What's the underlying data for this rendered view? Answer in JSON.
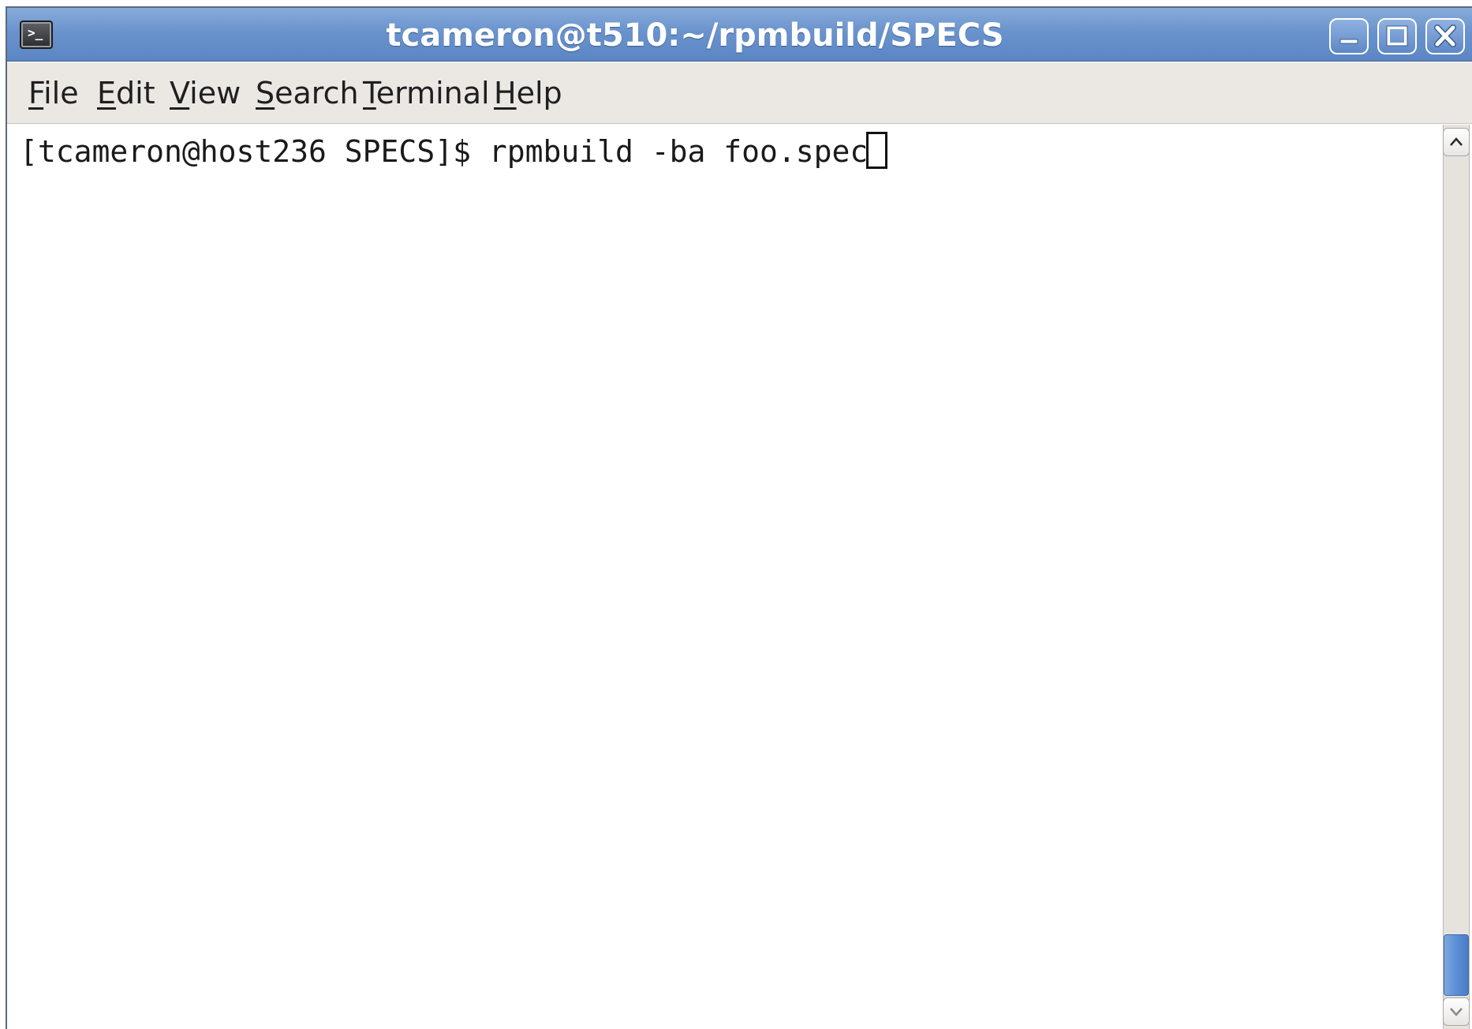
{
  "window": {
    "title": "tcameron@t510:~/rpmbuild/SPECS",
    "app_icon_glyph": ">_",
    "controls": [
      "minimize-icon",
      "maximize-icon",
      "close-icon"
    ]
  },
  "menu": {
    "items": [
      {
        "mnemonic": "F",
        "rest": "ile"
      },
      {
        "mnemonic": "E",
        "rest": "dit"
      },
      {
        "mnemonic": "V",
        "rest": "iew"
      },
      {
        "mnemonic": "S",
        "rest": "earch"
      },
      {
        "mnemonic": "T",
        "rest": "erminal"
      },
      {
        "mnemonic": "H",
        "rest": "elp"
      }
    ]
  },
  "terminal": {
    "lines": [
      "[tcameron@host236 SPECS]$ rpmbuild -ba foo.spec "
    ]
  },
  "scrollbar": {
    "position": 1.0
  },
  "colors": {
    "titlebar": "#6a93cd",
    "menubar": "#ebe8e4",
    "scroll_thumb": "#5b8fd6"
  }
}
